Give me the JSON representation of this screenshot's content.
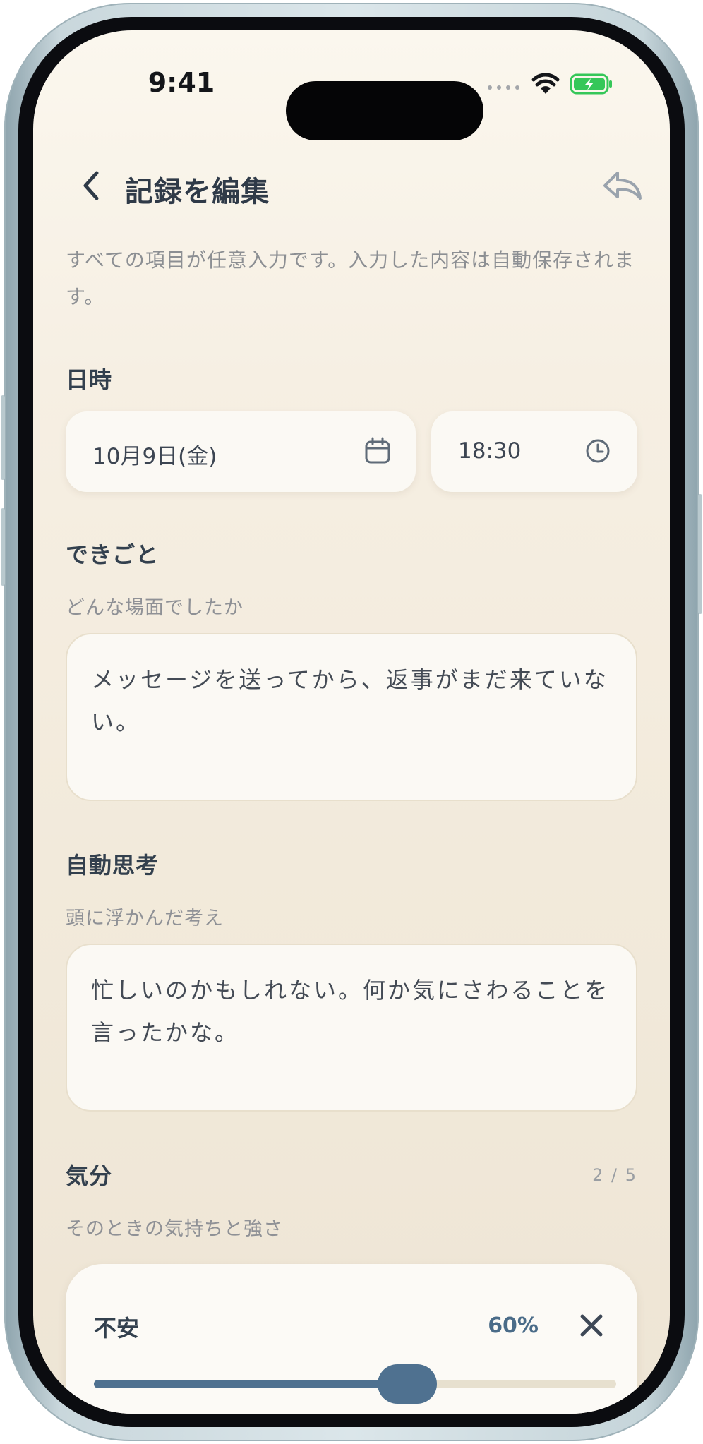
{
  "status_bar": {
    "time": "9:41"
  },
  "nav": {
    "title": "記録を編集"
  },
  "intro": "すべての項目が任意入力です。入力した内容は自動保存されます。",
  "datetime": {
    "label": "日時",
    "date": "10月9日(金)",
    "time": "18:30"
  },
  "event": {
    "label": "できごと",
    "hint": "どんな場面でしたか",
    "value": "メッセージを送ってから、返事がまだ来ていない。"
  },
  "thought": {
    "label": "自動思考",
    "hint": "頭に浮かんだ考え",
    "value": "忙しいのかもしれない。何か気にさわることを言ったかな。"
  },
  "mood": {
    "label": "気分",
    "hint": "そのときの気持ちと強さ",
    "counter": "2 / 5",
    "items": [
      {
        "name": "不安",
        "percent_label": "60%",
        "level": 0.6
      }
    ]
  },
  "colors": {
    "accent": "#4f7190",
    "title": "#33404e",
    "background": "#f4ede0"
  }
}
